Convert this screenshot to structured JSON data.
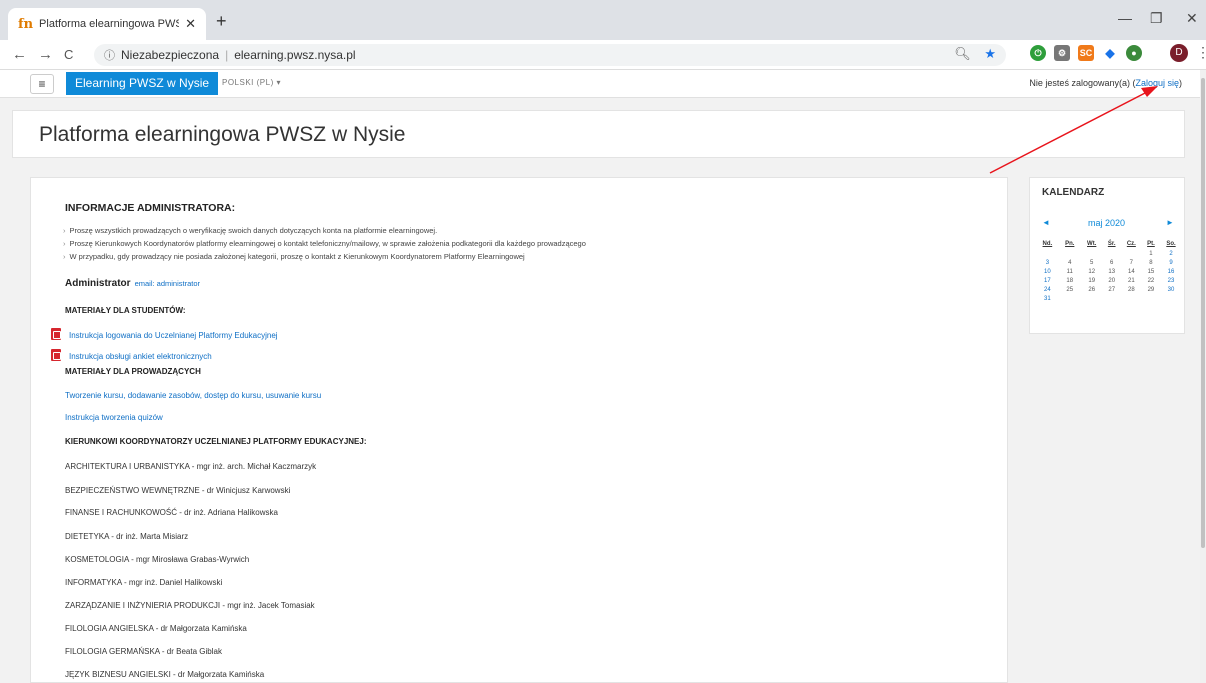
{
  "browser": {
    "tab_title": "Platforma elearningowa PWSZ w",
    "tab_favicon": "fn",
    "new_tab": "+",
    "address_security": "Niezabezpieczona",
    "address_url": "elearning.pwsz.nysa.pl",
    "minimize": "—",
    "maximize": "❐",
    "close": "✕",
    "back": "←",
    "forward": "→",
    "reload": "C",
    "avatar_letter": "D",
    "ext_sc": "SC"
  },
  "navbar": {
    "menu_icon": "≡",
    "brand": "Elearning PWSZ w Nysie",
    "language": "POLSKI (PL) ▾",
    "login_text": "Nie jesteś zalogowany(a) (",
    "login_link": "Zaloguj się",
    "login_end": ")"
  },
  "page": {
    "title": "Platforma elearningowa PWSZ w Nysie"
  },
  "admin_info": {
    "heading": "INFORMACJE ADMINISTRATORA:",
    "bullets": [
      "Proszę wszystkich prowadzących o weryfikację swoich danych dotyczących konta na platformie elearningowej.",
      "Proszę Kierunkowych Koordynatorów platformy elearningowej o kontakt telefoniczny/mailowy, w sprawie założenia podkategorii dla każdego prowadzącego",
      "W przypadku, gdy prowadzący nie posiada założonej kategorii, proszę o kontakt z Kierunkowym Koordynatorem Platformy Elearningowej"
    ],
    "administrator_label": "Administrator",
    "administrator_links": "email: administrator"
  },
  "students": {
    "heading": "MATERIAŁY DLA STUDENTÓW:",
    "links": [
      "Instrukcja logowania do Uczelnianej Platformy Edukacyjnej",
      "Instrukcja obsługi ankiet elektronicznych"
    ]
  },
  "teachers": {
    "heading": "MATERIAŁY DLA PROWADZĄCYCH",
    "links": [
      "Tworzenie kursu, dodawanie zasobów, dostęp do kursu, usuwanie kursu",
      "Instrukcja tworzenia quizów"
    ]
  },
  "coordinators": {
    "heading": "KIERUNKOWI KOORDYNATORZY UCZELNIANEJ PLATFORMY EDUKACYJNEJ:",
    "items": [
      "ARCHITEKTURA I URBANISTYKA - mgr inż. arch. Michał Kaczmarzyk",
      "BEZPIECZEŃSTWO WEWNĘTRZNE - dr Winicjusz Karwowski",
      "FINANSE I RACHUNKOWOŚĆ - dr inż. Adriana Halikowska",
      "DIETETYKA - dr inż. Marta Misiarz",
      "KOSMETOLOGIA - mgr Mirosława Grabas-Wyrwich",
      "INFORMATYKA - mgr inż. Daniel Halikowski",
      "ZARZĄDZANIE I INŻYNIERIA PRODUKCJI - mgr inż. Jacek Tomasiak",
      "FILOLOGIA ANGIELSKA - dr Małgorzata Kamińska",
      "FILOLOGIA GERMAŃSKA - dr Beata Giblak",
      "JĘZYK BIZNESU ANGIELSKI - dr Małgorzata Kamińska"
    ]
  },
  "calendar": {
    "title": "KALENDARZ",
    "prev": "◄",
    "next": "►",
    "month": "maj 2020",
    "weekdays": [
      "Nd.",
      "Pn.",
      "Wt.",
      "Śr.",
      "Cz.",
      "Pt.",
      "So."
    ],
    "weeks": [
      [
        "",
        "",
        "",
        "",
        "",
        "1",
        "2"
      ],
      [
        "3",
        "4",
        "5",
        "6",
        "7",
        "8",
        "9"
      ],
      [
        "10",
        "11",
        "12",
        "13",
        "14",
        "15",
        "16"
      ],
      [
        "17",
        "18",
        "19",
        "20",
        "21",
        "22",
        "23"
      ],
      [
        "24",
        "25",
        "26",
        "27",
        "28",
        "29",
        "30"
      ],
      [
        "31",
        "",
        "",
        "",
        "",
        "",
        ""
      ]
    ]
  },
  "colors": {
    "brand": "#0f8ad8",
    "link": "#0f6fc5",
    "annotation_arrow": "#e8141c"
  }
}
